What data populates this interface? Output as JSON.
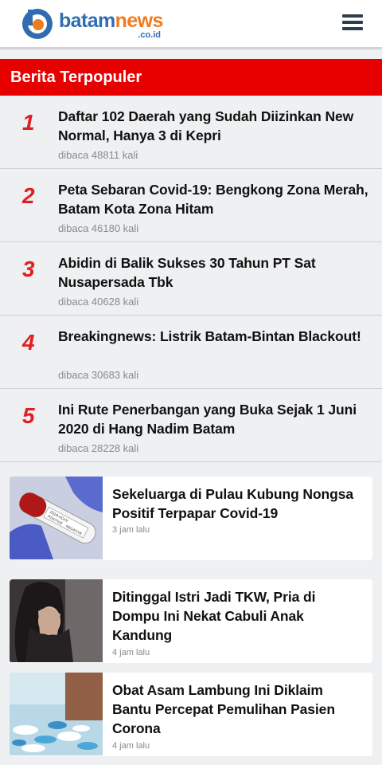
{
  "header": {
    "logo_word_1": "batam",
    "logo_word_2": "news",
    "logo_domain": ".co.id"
  },
  "section": {
    "title": "Berita Terpopuler"
  },
  "popular": [
    {
      "rank": "1",
      "title": "Daftar 102 Daerah yang Sudah Diizinkan New Normal, Hanya 3 di Kepri",
      "views": "dibaca 48811 kali"
    },
    {
      "rank": "2",
      "title": "Peta Sebaran Covid-19: Bengkong Zona Merah, Batam Kota Zona Hitam",
      "views": "dibaca 46180 kali"
    },
    {
      "rank": "3",
      "title": "Abidin di Balik Sukses 30 Tahun PT Sat Nusapersada Tbk",
      "views": "dibaca 40628 kali"
    },
    {
      "rank": "4",
      "title": "Breakingnews: Listrik Batam-Bintan Blackout!",
      "views": "dibaca 30683 kali"
    },
    {
      "rank": "5",
      "title": "Ini Rute Penerbangan yang Buka Sejak 1 Juni 2020 di Hang Nadim Batam",
      "views": "dibaca 28228 kali"
    }
  ],
  "articles": [
    {
      "title": "Sekeluarga di Pulau Kubung Nongsa Positif Terpapar Covid-19",
      "time": "3 jam lalu",
      "thumb_icon": "covid-test-tube-image",
      "thumb_text_1": "POSITIVE",
      "thumb_text_2": "NEGATIVE",
      "thumb_text_3": "2019-nCoV"
    },
    {
      "title": "Ditinggal Istri Jadi TKW, Pria di Dompu Ini Nekat Cabuli Anak Kandung",
      "time": "4 jam lalu",
      "thumb_icon": "sad-woman-image"
    },
    {
      "title": "Obat Asam Lambung Ini Diklaim Bantu Percepat Pemulihan Pasien Corona",
      "time": "4 jam lalu",
      "thumb_icon": "pills-image"
    }
  ],
  "colors": {
    "accent_red": "#e60000",
    "rank_red": "#e02020",
    "logo_blue": "#2f6db0",
    "logo_orange": "#f07c20"
  }
}
